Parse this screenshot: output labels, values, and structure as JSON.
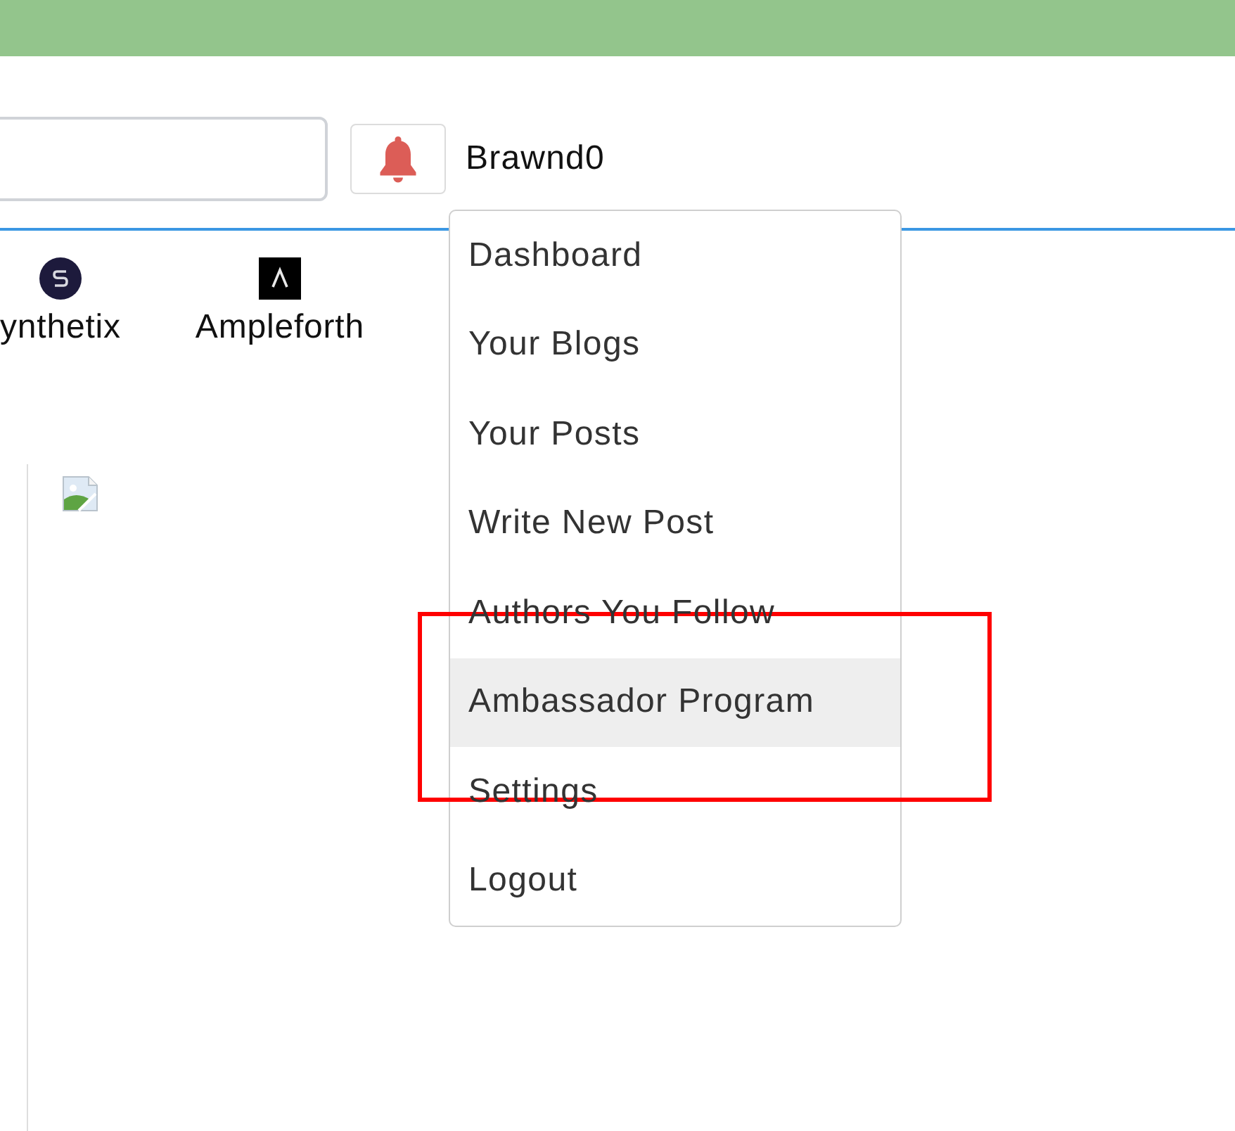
{
  "header": {
    "username": "Brawnd0"
  },
  "tokens": [
    {
      "name": "ynthetix",
      "kind": "round"
    },
    {
      "name": "Ampleforth",
      "kind": "square"
    }
  ],
  "user_menu": {
    "items": [
      {
        "label": "Dashboard",
        "selected": false
      },
      {
        "label": "Your Blogs",
        "selected": false
      },
      {
        "label": "Your Posts",
        "selected": false
      },
      {
        "label": "Write New Post",
        "selected": false
      },
      {
        "label": "Authors You Follow",
        "selected": false
      },
      {
        "label": "Ambassador Program",
        "selected": true
      },
      {
        "label": "Settings",
        "selected": false
      },
      {
        "label": "Logout",
        "selected": false
      }
    ]
  }
}
